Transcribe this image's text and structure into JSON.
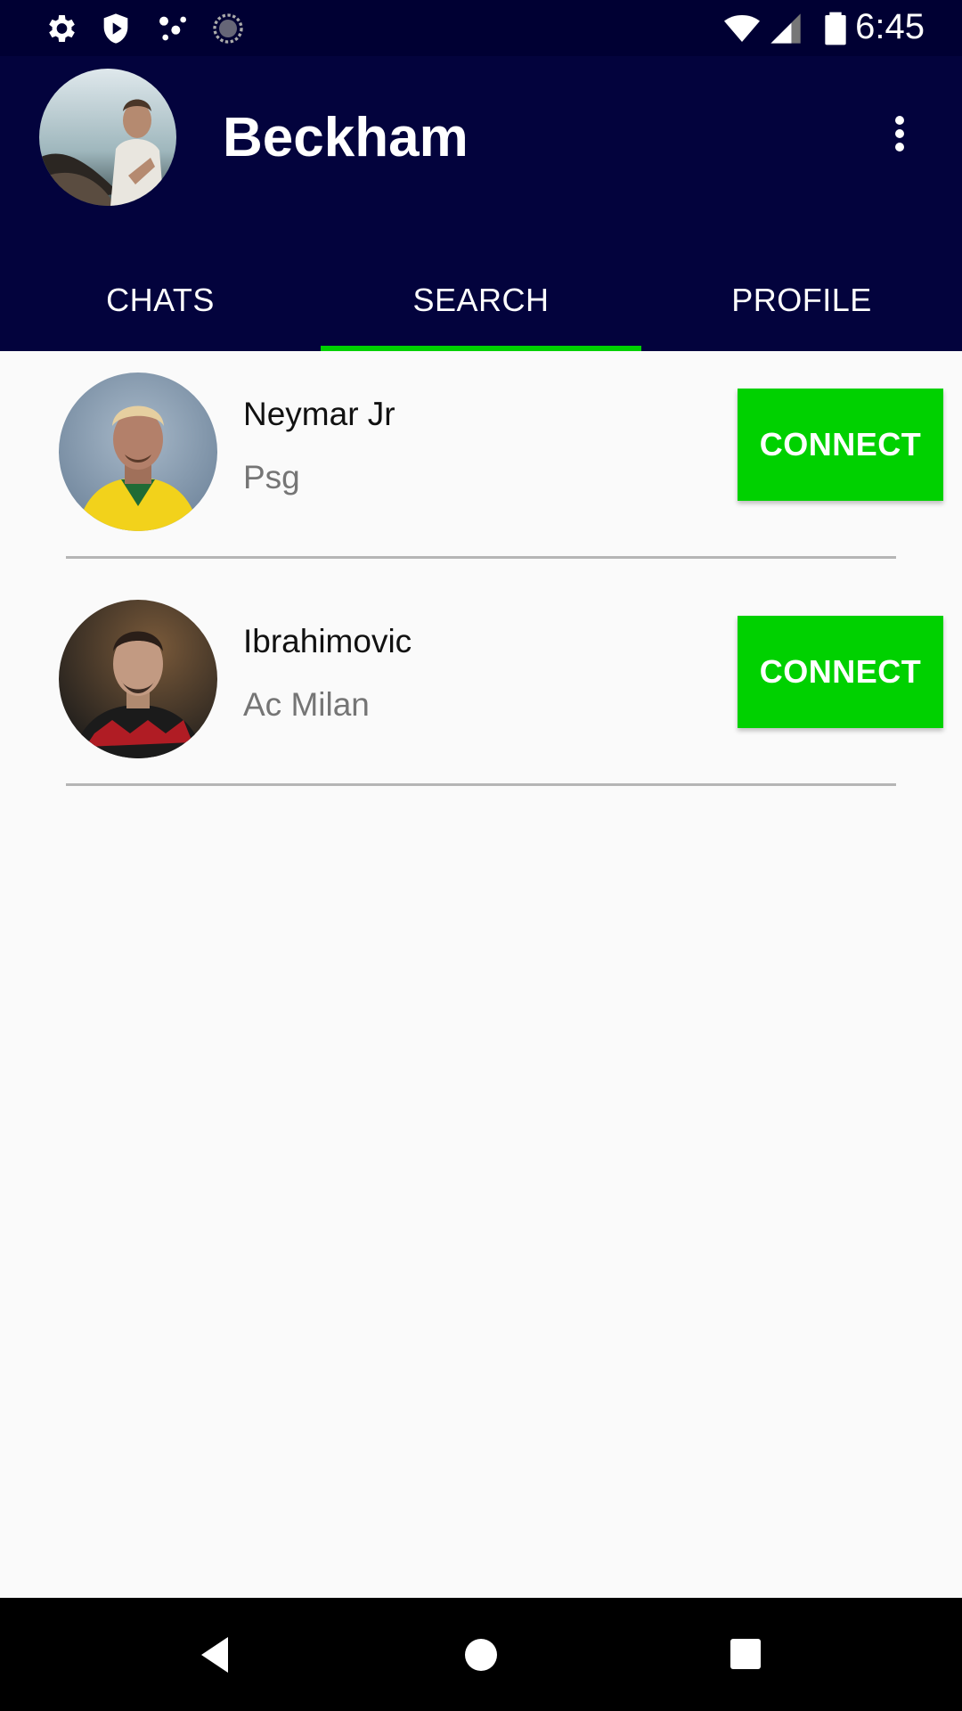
{
  "status_bar": {
    "time": "6:45",
    "icons_left": [
      "gear-icon",
      "shield-icon",
      "dots-icon",
      "sync-icon"
    ],
    "icons_right": [
      "wifi-icon",
      "signal-icon",
      "battery-icon"
    ]
  },
  "app_bar": {
    "title": "Beckham",
    "menu_icon": "more-vert-icon"
  },
  "tabs": [
    {
      "label": "CHATS",
      "selected": false
    },
    {
      "label": "SEARCH",
      "selected": true
    },
    {
      "label": "PROFILE",
      "selected": false
    }
  ],
  "colors": {
    "app_bar_bg": "#03033d",
    "accent_green": "#00d100",
    "name_text": "#111111",
    "secondary_text": "#757575"
  },
  "users": [
    {
      "name": "Neymar Jr",
      "team": "Psg",
      "action": "CONNECT"
    },
    {
      "name": "Ibrahimovic",
      "team": "Ac Milan",
      "action": "CONNECT"
    }
  ],
  "nav_bar": {
    "buttons": [
      "back-icon",
      "home-icon",
      "recents-icon"
    ]
  }
}
